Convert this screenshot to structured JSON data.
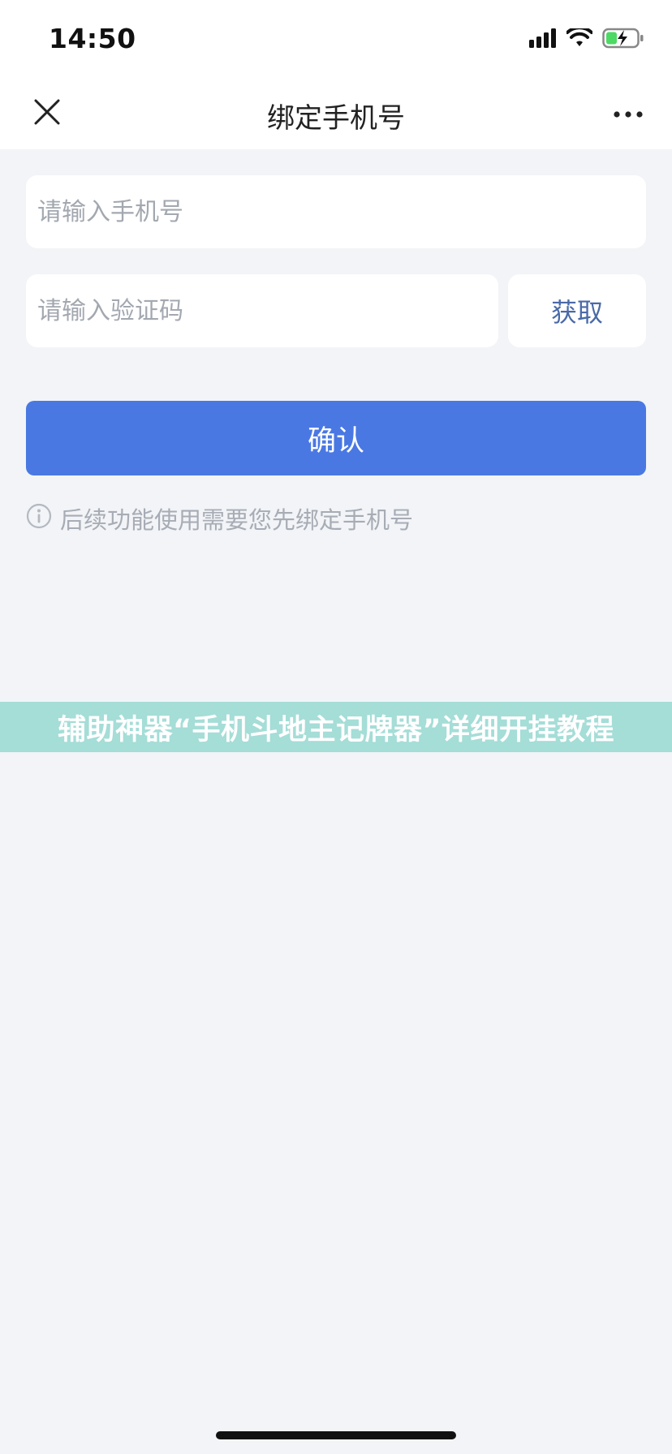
{
  "status_bar": {
    "time": "14:50",
    "icons": [
      "signal-icon",
      "wifi-icon",
      "battery-charging-icon"
    ]
  },
  "nav": {
    "title": "绑定手机号",
    "close_icon": "close-icon",
    "more_icon": "more-icon"
  },
  "form": {
    "phone_placeholder": "请输入手机号",
    "phone_value": "",
    "code_placeholder": "请输入验证码",
    "code_value": "",
    "get_code_label": "获取",
    "confirm_label": "确认",
    "hint": "后续功能使用需要您先绑定手机号"
  },
  "banner": {
    "text": "辅助神器“手机斗地主记牌器”详细开挂教程"
  },
  "colors": {
    "accent": "#4a78e3",
    "link": "#4a6aa8",
    "banner": "#a5ddd7",
    "background": "#f2f4f7"
  }
}
